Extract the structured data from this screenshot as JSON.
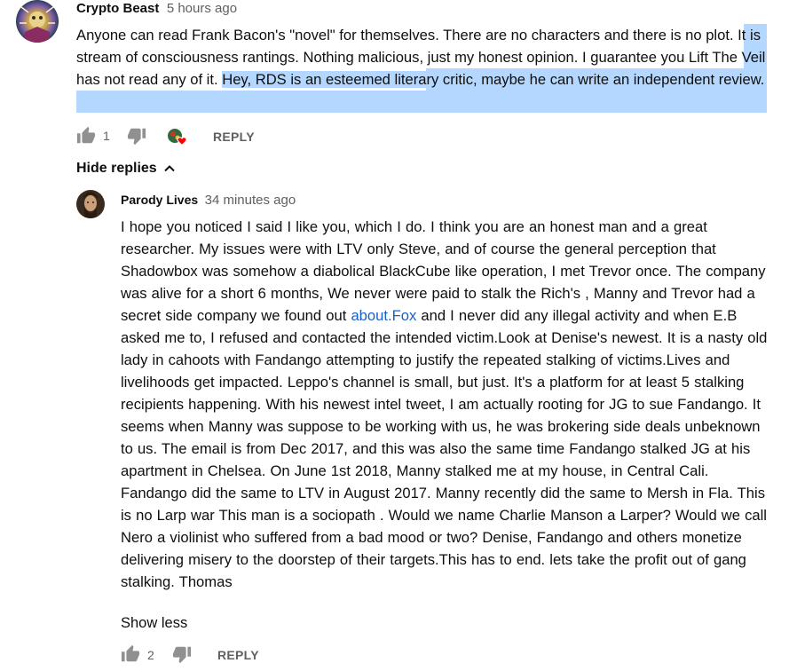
{
  "comment": {
    "author": "Crypto Beast",
    "time": "5 hours ago",
    "text_plain": "Anyone can read Frank Bacon's \"novel\" for themselves. There are no characters and there is no plot. It is stream of consciousness rantings. Nothing malicious, just my honest opinion. I guarantee you Lift The Veil has not read any of it.",
    "text_selected": "Hey, RDS is an esteemed literary critic, maybe he can write an independent review.",
    "likes": "1",
    "reply_label": "REPLY"
  },
  "replies_toggle": {
    "label": "Hide replies",
    "icon": "chevron-up-icon"
  },
  "reply": {
    "author": "Parody Lives",
    "time": "34 minutes ago",
    "text_before_link": "I hope you noticed I said I like you, which I do. I think you are an honest man and a great researcher. My issues were with LTV only Steve, and  of course the general perception that Shadowbox was somehow a diabolical  BlackCube  like operation, I met Trevor once. The company was alive for a short 6 months, We never were paid to stalk the Rich's , Manny and Trevor had a secret side company we found out",
    "link_text": "about.Fox",
    "text_after_link": " and I never did any illegal activity and when E.B asked me to, I refused and contacted the intended victim.Look at Denise's newest. It is a nasty old lady in cahoots with Fandango attempting to justify the repeated stalking of victims.Lives and livelihoods get impacted. Leppo's channel is small, but just. It's a platform for at least 5 stalking recipients happening. With his newest intel tweet, I am actually rooting for JG to sue Fandango. It seems when Manny was suppose to be working with us, he was brokering side deals unbeknown to us. The email is from Dec 2017, and this was also the same time Fandango stalked JG at his apartment in Chelsea. On June 1st 2018, Manny stalked me at my house, in Central Cali. Fandango did the same to LTV in August 2017. Manny recently did the same to Mersh in Fla. This is no Larp war This man is a sociopath . Would we name Charlie Manson a Larper? Would we call Nero a violinist who suffered from a bad mood or two? Denise, Fandango and others monetize delivering  misery to the doorstep  of their targets.This has to end. lets take the profit out of gang stalking. Thomas",
    "show_less_label": "Show less",
    "likes": "2",
    "reply_label": "REPLY"
  },
  "colors": {
    "selection": "#b3d7fe",
    "link": "#1a5ec8",
    "secondary_text": "#606060",
    "heart": "#ff0000"
  }
}
